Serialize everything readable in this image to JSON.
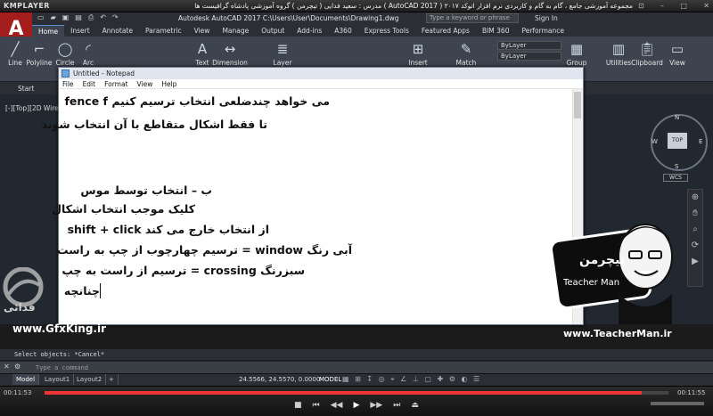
{
  "player": {
    "logo": "KMPLAYER",
    "caption": "مجموعه آموزشی جامع ، گام به گام و کاربردی نرم افزار  اتوکد ۲۰۱۷ ( AutoCAD 2017 )  مدرس : سعید فدایی ( تیچرمن ) گروه آموزشی پادشاه گرافیست ها",
    "time_current": "00:11:53",
    "time_total": "00:11:55",
    "progress": 0.957
  },
  "acad": {
    "logo": "A",
    "title": "Autodesk AutoCAD 2017   C:\\Users\\User\\Documents\\Drawing1.dwg",
    "search_placeholder": "Type a keyword or phrase",
    "signin": "Sign In",
    "tabs": [
      "Home",
      "Insert",
      "Annotate",
      "Parametric",
      "View",
      "Manage",
      "Output",
      "Add-ins",
      "A360",
      "Express Tools",
      "Featured Apps",
      "BIM 360",
      "Performance"
    ],
    "tools": {
      "line": "Line",
      "polyline": "Polyline",
      "circle": "Circle",
      "arc": "Arc",
      "text": "Text",
      "dimension": "Dimension",
      "layer": "Layer",
      "insert": "Insert",
      "match": "Match",
      "group": "Group",
      "utilities": "Utilities",
      "clipboard": "Clipboard",
      "view": "View"
    },
    "bylayer_1": "ByLayer",
    "bylayer_2": "ByLayer",
    "start_tab": "Start",
    "view_label": "[-][Top][2D Wireframe]",
    "viewcube": {
      "top": "TOP",
      "n": "N",
      "s": "S",
      "e": "E",
      "w": "W",
      "wcs": "WCS"
    },
    "cmd_history": "Select objects: *Cancel*",
    "cmd_placeholder": "Type a command",
    "layout_tabs": [
      "Model",
      "Layout1",
      "Layout2",
      "+"
    ],
    "coords": "24.5566, 24.5570, 0.0000",
    "model_label": "MODEL"
  },
  "notepad": {
    "title": "Untitled - Notepad",
    "menu": [
      "File",
      "Edit",
      "Format",
      "View",
      "Help"
    ],
    "lines": [
      "می خواهد چندضلعی انتخاب ترسیم کنیم  fence  f",
      "تا فقط اشکال متقاطع با آن انتخاب شوند",
      "ب – انتخاب توسط موس",
      "کلیک موجب انتخاب اشکال",
      "از انتخاب خارج می کند  shift + click",
      "آبی رنگ   window  = ترسیم چهارچوب از چپ به راست",
      "سبزرنگ  crossing = ترسیم از راست به چپ",
      "چنانچه"
    ]
  },
  "watermark": {
    "left_text": "فدائی",
    "gfx_url": "www.GfxKing.ir",
    "badge_fa": "تیچرمن",
    "badge_en": "Teacher Man",
    "tm_url": "www.TeacherMan.ir"
  }
}
